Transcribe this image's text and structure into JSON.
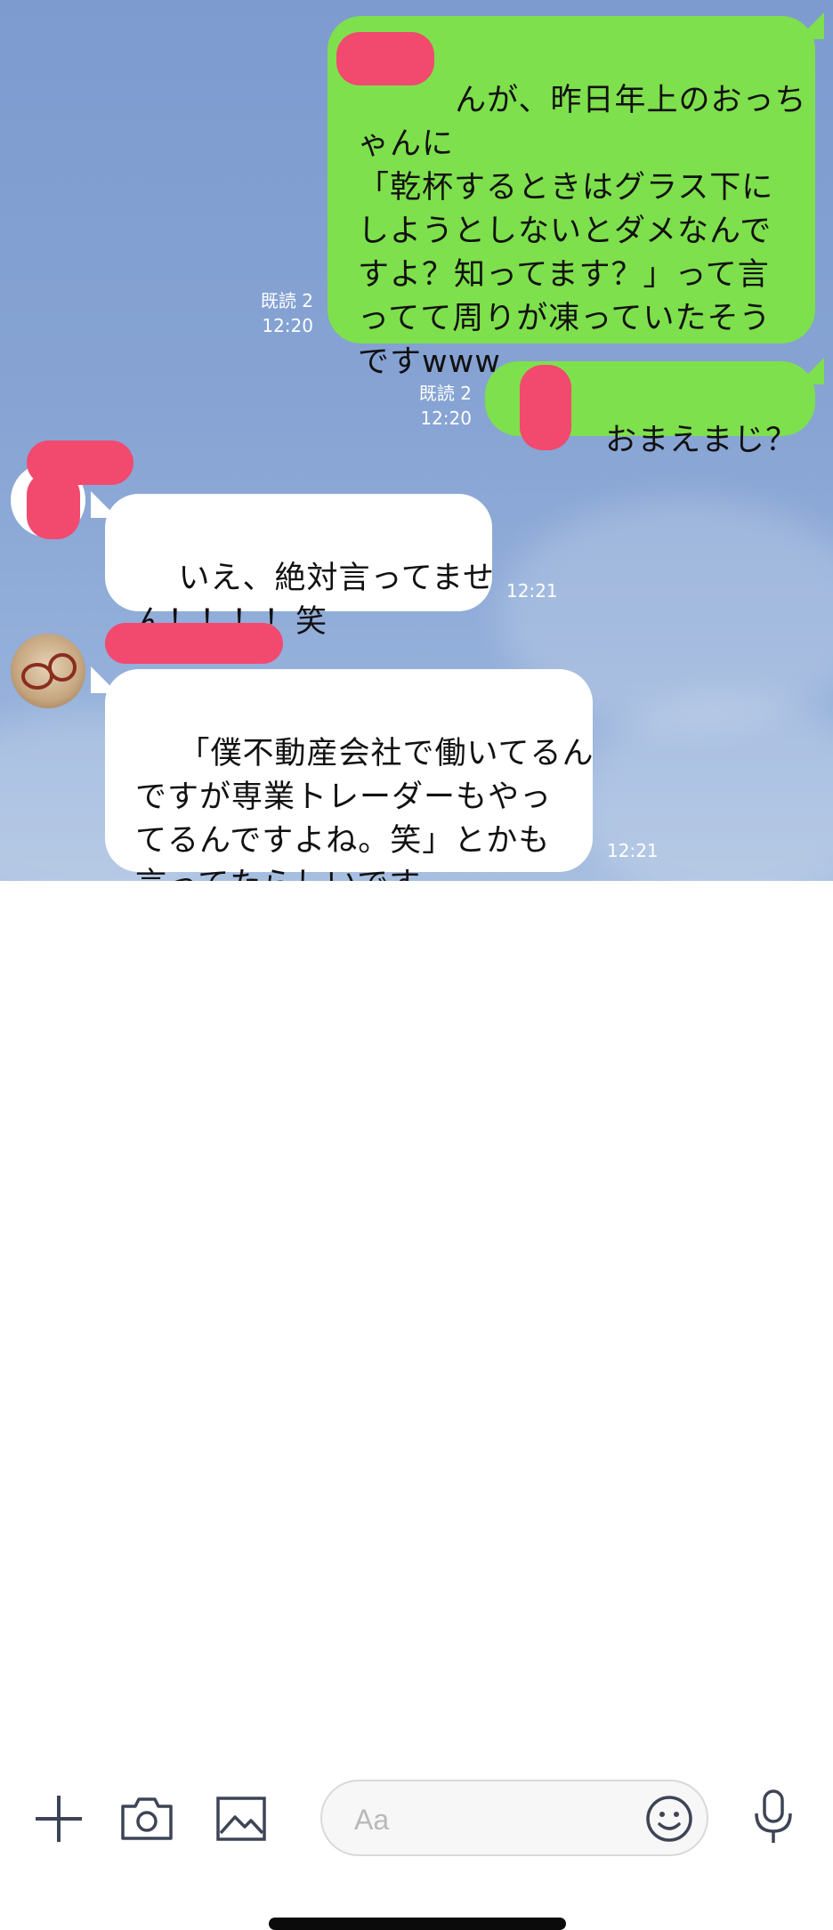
{
  "messages": [
    {
      "side": "sent",
      "read": "既読 2",
      "time": "12:20",
      "text": "     んが、昨日年上のおっち\nゃんに\n「乾杯するときはグラス下に\nしようとしないとダメなんで\nすよ？知ってます？」って言\nってて周りが凍っていたそう\nですwww"
    },
    {
      "side": "sent",
      "read": "既読 2",
      "time": "12:20",
      "text": "     おまえまじ？"
    },
    {
      "side": "received",
      "time": "12:21",
      "text": "いえ、絶対言ってませ\nん！！！！笑"
    },
    {
      "side": "received",
      "time": "12:21",
      "text": "「僕不動産会社で働いてるん\nですが専業トレーダーもやっ\nてるんですよね。笑」とかも\n言ってたらしいです"
    }
  ],
  "input": {
    "placeholder": "Aa"
  },
  "icons": {
    "add": "plus-icon",
    "camera": "camera-icon",
    "image": "image-icon",
    "emoji": "emoji-icon",
    "mic": "microphone-icon"
  },
  "colors": {
    "sent_bubble": "#7ee04c",
    "received_bubble": "#ffffff",
    "redaction": "#f2496f",
    "background": "#86a3d3"
  }
}
